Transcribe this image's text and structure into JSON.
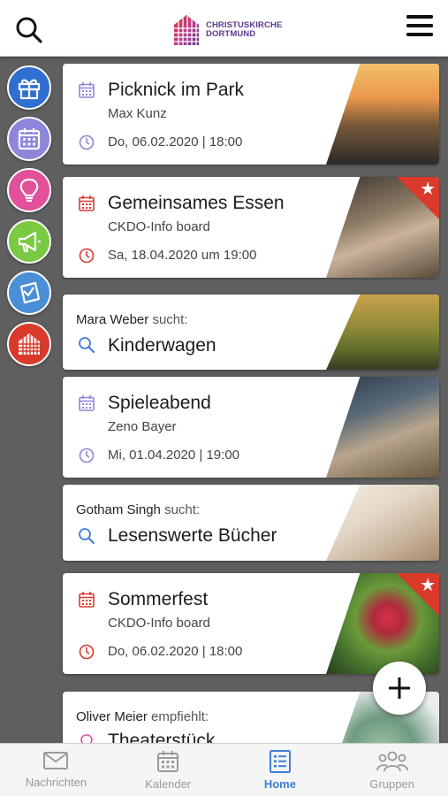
{
  "header": {
    "logo_line1": "CHRISTUSKIRCHE",
    "logo_line2": "DORTMUND"
  },
  "sidebar": {
    "items": [
      {
        "icon": "gift-icon",
        "color": "#2f6fd1"
      },
      {
        "icon": "calendar-icon",
        "color": "#8d86d9"
      },
      {
        "icon": "lightbulb-icon",
        "color": "#e2509a"
      },
      {
        "icon": "megaphone-icon",
        "color": "#7ac943"
      },
      {
        "icon": "note-icon",
        "color": "#4a8fd6"
      },
      {
        "icon": "church-icon",
        "color": "#d93a2b"
      }
    ]
  },
  "feed": {
    "cards": [
      {
        "type": "event",
        "title": "Picknick im Park",
        "subtitle": "Max Kunz",
        "date": "Do, 06.02.2020 | 18:00",
        "accent": "#8d86d9",
        "featured": false
      },
      {
        "type": "event",
        "title": "Gemeinsames Essen",
        "subtitle": "CKDO-Info board",
        "date": "Sa, 18.04.2020 um 19:00",
        "accent": "#d93a2b",
        "featured": true
      },
      {
        "type": "search",
        "person": "Mara Weber",
        "verb": "sucht:",
        "title": "Kinderwagen",
        "accent": "#3d7ed8"
      },
      {
        "type": "event",
        "title": "Spieleabend",
        "subtitle": "Zeno Bayer",
        "date": "Mi, 01.04.2020 | 19:00",
        "accent": "#8d86d9",
        "featured": false
      },
      {
        "type": "search",
        "person": "Gotham Singh",
        "verb": "sucht:",
        "title": "Lesenswerte Bücher",
        "accent": "#3d7ed8"
      },
      {
        "type": "event",
        "title": "Sommerfest",
        "subtitle": "CKDO-Info board",
        "date": "Do, 06.02.2020 | 18:00",
        "accent": "#d93a2b",
        "featured": true
      },
      {
        "type": "recommend",
        "person": "Oliver Meier",
        "verb": "empfiehlt:",
        "title": "Theaterstück",
        "accent": "#e2509a"
      }
    ]
  },
  "bottom_nav": {
    "items": [
      {
        "label": "Nachrichten",
        "icon": "mail-icon",
        "active": false
      },
      {
        "label": "Kalender",
        "icon": "calendar-icon",
        "active": false
      },
      {
        "label": "Home",
        "icon": "home-list-icon",
        "active": true
      },
      {
        "label": "Gruppen",
        "icon": "group-icon",
        "active": false
      }
    ]
  },
  "colors": {
    "accent_blue": "#3d7ed8",
    "accent_red": "#d93a2b",
    "accent_purple": "#8d86d9",
    "background": "#5f5f5f"
  }
}
